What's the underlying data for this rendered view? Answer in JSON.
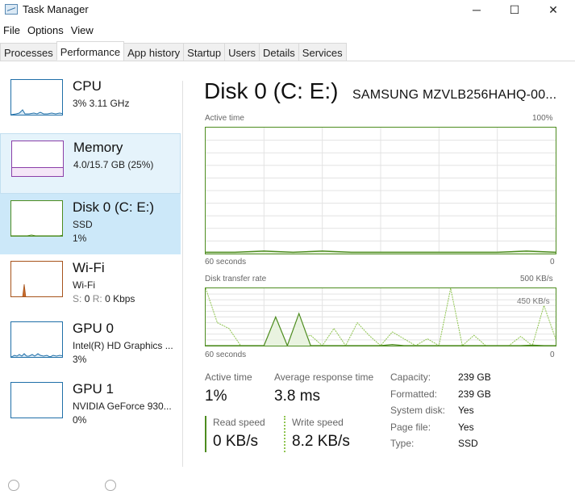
{
  "window": {
    "title": "Task Manager",
    "controls": {
      "minimize": "─",
      "maximize": "☐",
      "close": "✕"
    }
  },
  "menu": [
    "File",
    "Options",
    "View"
  ],
  "tabs": [
    {
      "label": "Processes",
      "active": false
    },
    {
      "label": "Performance",
      "active": true
    },
    {
      "label": "App history",
      "active": false
    },
    {
      "label": "Startup",
      "active": false
    },
    {
      "label": "Users",
      "active": false
    },
    {
      "label": "Details",
      "active": false
    },
    {
      "label": "Services",
      "active": false
    }
  ],
  "sidebar": {
    "items": [
      {
        "title": "CPU",
        "sub": "3% 3.11 GHz",
        "sub2": "",
        "color": "#1f6fa8",
        "state": "normal"
      },
      {
        "title": "Memory",
        "sub": "4.0/15.7 GB (25%)",
        "sub2": "",
        "color": "#8b3fa8",
        "state": "hover"
      },
      {
        "title": "Disk 0 (C: E:)",
        "sub": "SSD",
        "sub2": "1%",
        "color": "#4d8c1f",
        "state": "selected"
      },
      {
        "title": "Wi-Fi",
        "sub": "Wi-Fi",
        "sub2_label_s": "S:",
        "sub2_val_s": "0",
        "sub2_label_r": "R:",
        "sub2_val_r": "0 Kbps",
        "color": "#a7531b",
        "state": "normal"
      },
      {
        "title": "GPU 0",
        "sub": "Intel(R) HD Graphics ...",
        "sub2": "3%",
        "color": "#1f6fa8",
        "state": "normal"
      },
      {
        "title": "GPU 1",
        "sub": "NVIDIA GeForce 930...",
        "sub2": "0%",
        "color": "#1f6fa8",
        "state": "normal"
      }
    ]
  },
  "main": {
    "title": "Disk 0 (C: E:)",
    "model": "SAMSUNG MZVLB256HAHQ-00...",
    "active_graph": {
      "label": "Active time",
      "max_label": "100%",
      "time_label": "60 seconds",
      "min_label": "0"
    },
    "transfer_graph": {
      "label": "Disk transfer rate",
      "max_label": "500 KB/s",
      "inner_label": "450 KB/s",
      "time_label": "60 seconds",
      "min_label": "0"
    },
    "stats": {
      "active_time_label": "Active time",
      "active_time_value": "1%",
      "avg_response_label": "Average response time",
      "avg_response_value": "3.8 ms",
      "read_speed_label": "Read speed",
      "read_speed_value": "0 KB/s",
      "write_speed_label": "Write speed",
      "write_speed_value": "8.2 KB/s"
    },
    "properties": [
      {
        "label": "Capacity:",
        "value": "239 GB"
      },
      {
        "label": "Formatted:",
        "value": "239 GB"
      },
      {
        "label": "System disk:",
        "value": "Yes"
      },
      {
        "label": "Page file:",
        "value": "Yes"
      },
      {
        "label": "Type:",
        "value": "SSD"
      }
    ]
  },
  "chart_data": [
    {
      "type": "line",
      "title": "Active time",
      "ylabel": "%",
      "ylim": [
        0,
        100
      ],
      "xlabel": "60 seconds",
      "x": [
        0,
        5,
        10,
        15,
        20,
        25,
        30,
        35,
        40,
        45,
        50,
        55,
        60
      ],
      "series": [
        {
          "name": "Active time",
          "values": [
            1,
            1,
            2,
            1,
            2,
            1,
            1,
            1,
            1,
            1,
            1,
            2,
            1
          ]
        }
      ]
    },
    {
      "type": "line",
      "title": "Disk transfer rate",
      "ylabel": "KB/s",
      "ylim": [
        0,
        500
      ],
      "xlabel": "60 seconds",
      "x": [
        0,
        2,
        4,
        6,
        8,
        10,
        12,
        14,
        16,
        18,
        20,
        22,
        24,
        26,
        28,
        30,
        32,
        34,
        36,
        38,
        40,
        42,
        44,
        46,
        48,
        50,
        52,
        54,
        56,
        58,
        60
      ],
      "series": [
        {
          "name": "Write speed",
          "values": [
            500,
            200,
            150,
            0,
            0,
            0,
            50,
            0,
            60,
            90,
            0,
            150,
            0,
            200,
            90,
            0,
            120,
            60,
            0,
            60,
            0,
            500,
            0,
            90,
            0,
            0,
            0,
            80,
            0,
            350,
            60
          ]
        },
        {
          "name": "Read speed",
          "values": [
            0,
            0,
            0,
            0,
            0,
            0,
            250,
            0,
            280,
            0,
            0,
            0,
            0,
            0,
            0,
            0,
            10,
            0,
            0,
            0,
            0,
            0,
            0,
            0,
            0,
            0,
            0,
            0,
            5,
            0,
            0
          ]
        }
      ]
    }
  ]
}
